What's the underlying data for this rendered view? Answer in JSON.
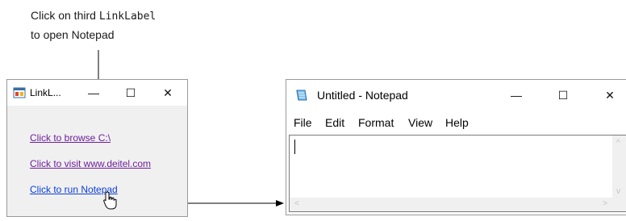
{
  "caption": {
    "line1_prefix": "Click on third ",
    "line1_code": "LinkLabel",
    "line2": "to open Notepad"
  },
  "linklabel_window": {
    "title": "LinkL...",
    "controls": {
      "minimize": "—",
      "maximize": "☐",
      "close": "✕"
    },
    "links": [
      {
        "text": "Click to browse C:\\",
        "state": "visited"
      },
      {
        "text": "Click to visit www.deitel.com",
        "state": "visited"
      },
      {
        "text": "Click to run Notepad",
        "state": "active"
      }
    ]
  },
  "notepad_window": {
    "title": "Untitled - Notepad",
    "controls": {
      "minimize": "—",
      "maximize": "☐",
      "close": "✕"
    },
    "menu": [
      "File",
      "Edit",
      "Format",
      "View",
      "Help"
    ],
    "scroll_arrows": {
      "up": "^",
      "down": "v",
      "left": "<",
      "right": ">"
    }
  },
  "colors": {
    "visited_link": "#6f1e9e",
    "active_link": "#0b3ed6",
    "window_background": "#f0f0f0"
  }
}
